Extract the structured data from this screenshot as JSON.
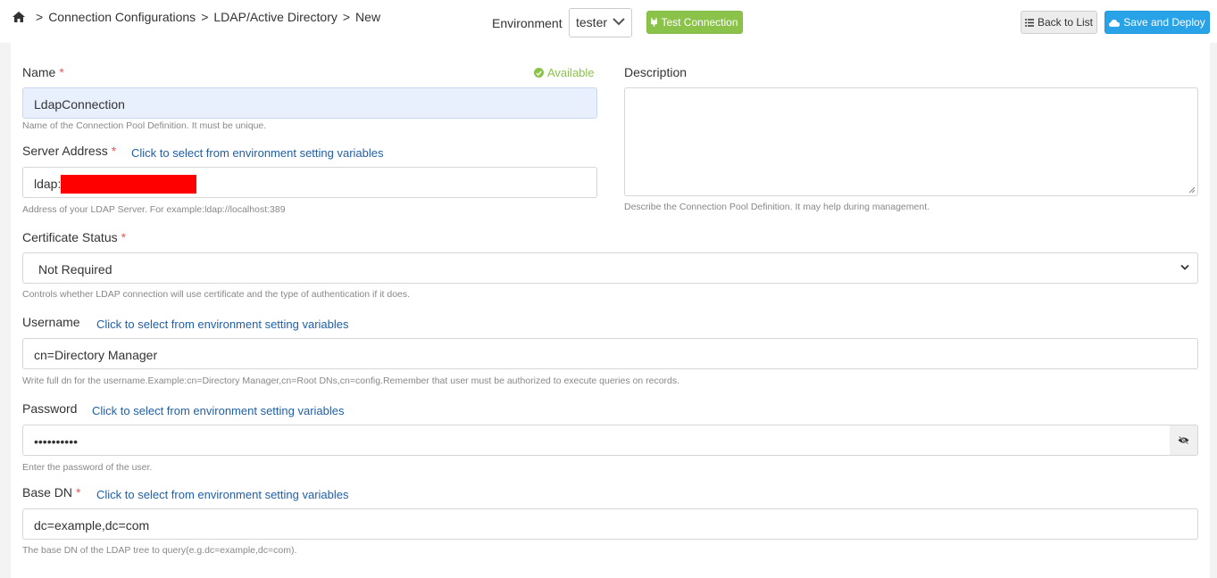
{
  "breadcrumb": {
    "home_icon": "home-icon",
    "items": [
      "Connection Configurations",
      "LDAP/Active Directory",
      "New"
    ],
    "separator": ">"
  },
  "environment": {
    "label": "Environment",
    "selected": "tester"
  },
  "toolbar": {
    "test_connection": "Test Connection",
    "back_to_list": "Back to List",
    "save_and_deploy": "Save and Deploy"
  },
  "form": {
    "env_link": "Click to select from environment setting variables",
    "name": {
      "label": "Name",
      "value": "LdapConnection",
      "status": "Available",
      "help": "Name of the Connection Pool Definition. It must be unique."
    },
    "description": {
      "label": "Description",
      "value": "",
      "help": "Describe the Connection Pool Definition. It may help during management."
    },
    "server_address": {
      "label": "Server Address",
      "value": "ldap:",
      "help": "Address of your LDAP Server. For example:ldap://localhost:389"
    },
    "certificate_status": {
      "label": "Certificate Status",
      "selected": "Not Required",
      "help": "Controls whether LDAP connection will use certificate and the type of authentication if it does."
    },
    "username": {
      "label": "Username",
      "value": "cn=Directory Manager",
      "help": "Write full dn for the username.Example:cn=Directory Manager,cn=Root DNs,cn=config.Remember that user must be authorized to execute queries on records."
    },
    "password": {
      "label": "Password",
      "value": "••••••••••",
      "help": "Enter the password of the user."
    },
    "base_dn": {
      "label": "Base DN",
      "value": "dc=example,dc=com",
      "help": "The base DN of the LDAP tree to query(e.g.dc=example,dc=com)."
    }
  },
  "colors": {
    "required": "#e45b5b",
    "link": "#1f5fa8",
    "success": "#8bc34a",
    "primary": "#29a3e8"
  }
}
